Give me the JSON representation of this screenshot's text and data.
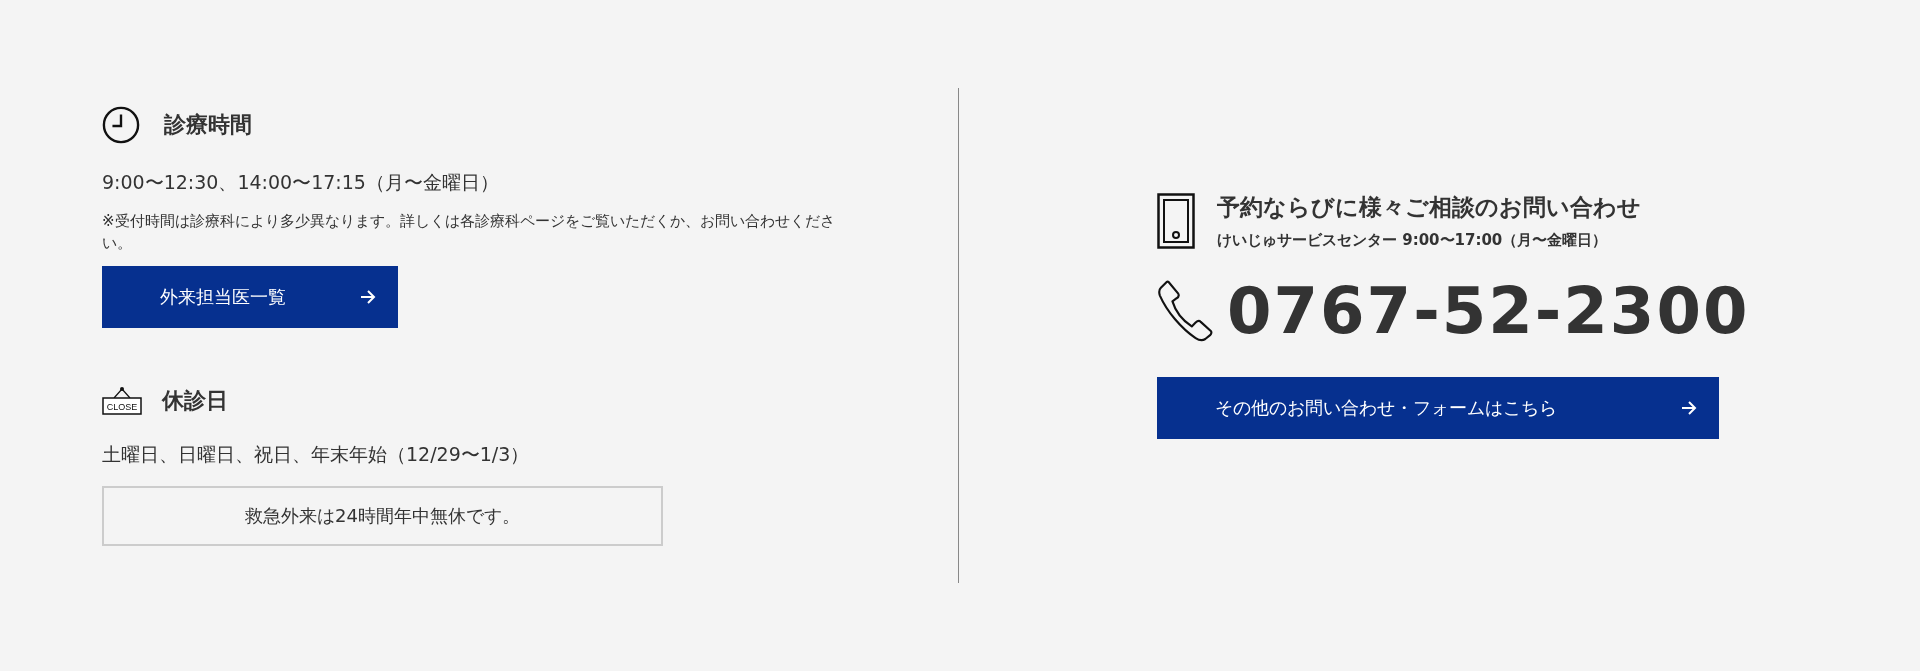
{
  "hours": {
    "title": "診療時間",
    "schedule": "9:00〜12:30、14:00〜17:15（月〜金曜日）",
    "note": "※受付時間は診療科により多少異なります。詳しくは各診療科ページをご覧いただくか、お問い合わせください。",
    "button": "外来担当医一覧"
  },
  "holidays": {
    "icon_label": "CLOSE",
    "title": "休診日",
    "days": "土曜日、日曜日、祝日、年末年始（12/29〜1/3）",
    "emergency": "救急外来は24時間年中無休です。"
  },
  "contact": {
    "title": "予約ならびに様々ご相談のお問い合わせ",
    "center": "けいじゅサービスセンター 9:00〜17:00（月〜金曜日）",
    "phone": "0767-52-2300",
    "button": "その他のお問い合わせ・フォームはこちら"
  }
}
